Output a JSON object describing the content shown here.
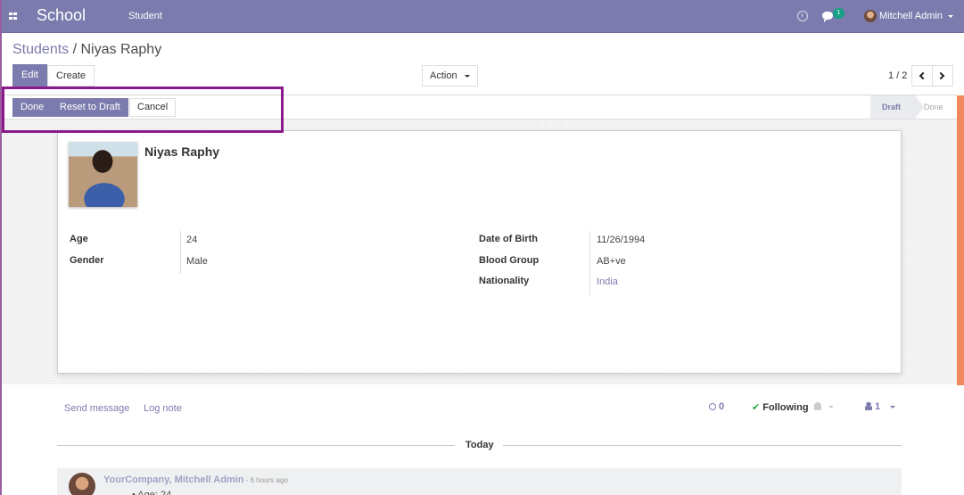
{
  "navbar": {
    "brand": "School",
    "menu_item": "Student",
    "chat_badge_count": "1",
    "user_name": "Mitchell Admin",
    "bg_color": "#7c7bad"
  },
  "breadcrumb": {
    "parent": "Students",
    "separator": " / ",
    "current": "Niyas Raphy"
  },
  "control_panel": {
    "edit_label": "Edit",
    "create_label": "Create",
    "action_label": "Action",
    "pager": "1 / 2"
  },
  "statusbar": {
    "buttons": {
      "done": "Done",
      "reset_to_draft": "Reset to Draft",
      "cancel": "Cancel"
    },
    "stages": {
      "draft": "Draft",
      "done": "Done"
    },
    "active_stage": "Draft"
  },
  "record": {
    "name": "Niyas Raphy",
    "left_fields": [
      {
        "label": "Age",
        "value": "24"
      },
      {
        "label": "Gender",
        "value": "Male"
      }
    ],
    "right_fields": [
      {
        "label": "Date of Birth",
        "value": "11/26/1994"
      },
      {
        "label": "Blood Group",
        "value": "AB+ve"
      },
      {
        "label": "Nationality",
        "value": "India"
      }
    ]
  },
  "chatter": {
    "send_message": "Send message",
    "log_note": "Log note",
    "attachments_count": "0",
    "following_label": "Following",
    "followers_count": "1",
    "date_separator": "Today",
    "messages": [
      {
        "author": "YourCompany, Mitchell Admin",
        "time": " - 6 hours ago",
        "body": "• Age: 24"
      }
    ]
  }
}
